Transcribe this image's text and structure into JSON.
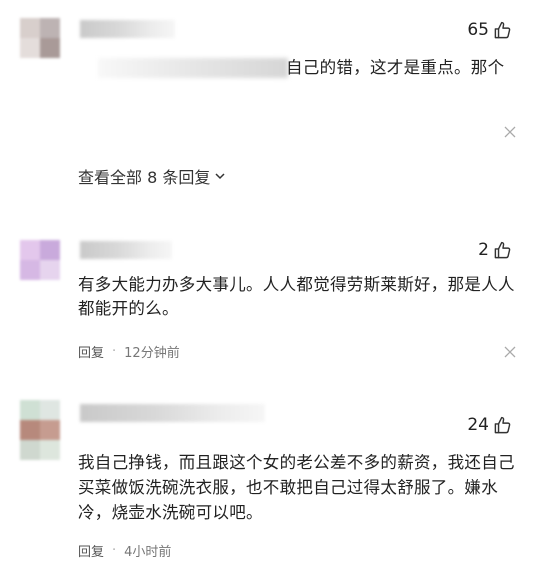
{
  "comments": [
    {
      "likes": "65",
      "text": "自己的错，这才是重点。那个",
      "view_all": "查看全部 8 条回复"
    },
    {
      "likes": "2",
      "text": "有多大能力办多大事儿。人人都觉得劳斯莱斯好，那是人人都能开的么。",
      "reply": "回复",
      "time": "12分钟前"
    },
    {
      "likes": "24",
      "text": "我自己挣钱，而且跟这个女的老公差不多的薪资，我还自己买菜做饭洗碗洗衣服，也不敢把自己过得太舒服了。嫌水冷，烧壶水洗碗可以吧。",
      "reply": "回复",
      "time": "4小时前"
    }
  ],
  "separator": "·",
  "icons": {
    "like": "thumb-up-icon",
    "close": "close-icon",
    "expand": "chevron-down-icon"
  }
}
